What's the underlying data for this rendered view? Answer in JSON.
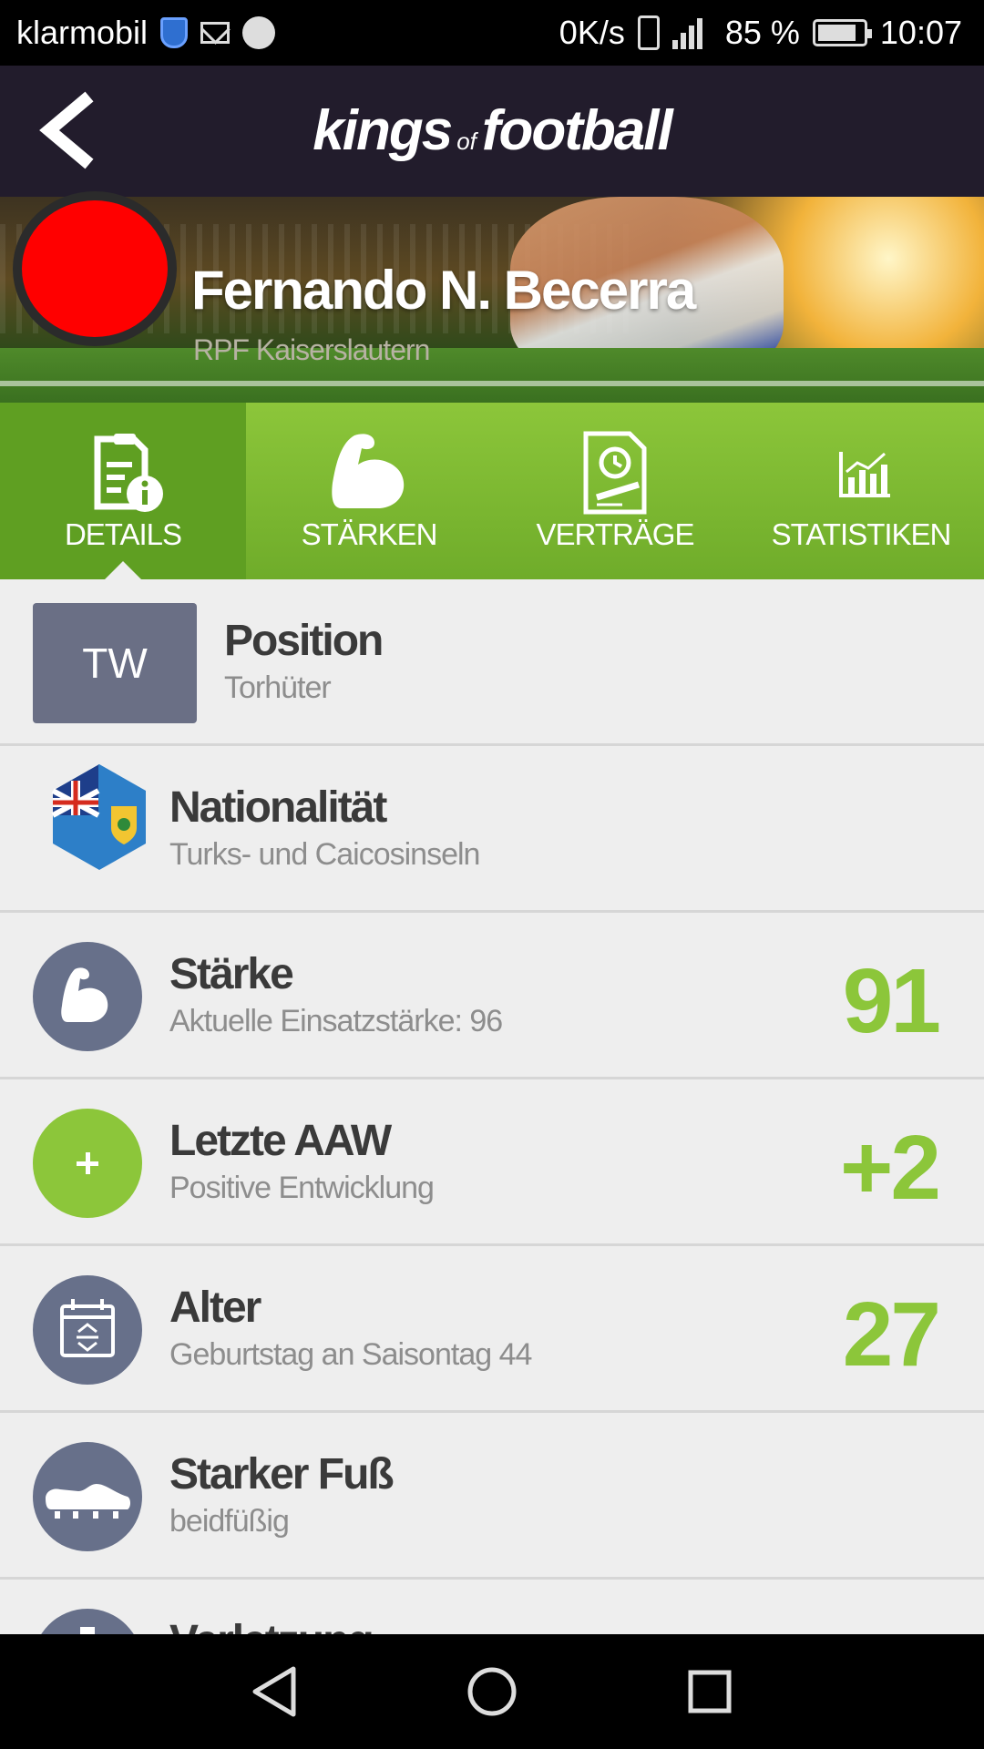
{
  "status_bar": {
    "carrier": "klarmobil",
    "speed": "0K/s",
    "battery": "85 %",
    "battery_level": 0.85,
    "time": "10:07",
    "icons": [
      "shield-icon",
      "mail-icon",
      "vodafone-icon",
      "vibrate-icon",
      "signal-icon",
      "battery-icon"
    ]
  },
  "header": {
    "logo_main1": "kings",
    "logo_of": "of",
    "logo_main2": "football"
  },
  "player": {
    "name": "Fernando N. Becerra",
    "club": "RPF Kaiserslautern",
    "avatar_color": "#ff0000"
  },
  "tabs": [
    {
      "label": "DETAILS",
      "icon": "document-info-icon",
      "active": true
    },
    {
      "label": "STÄRKEN",
      "icon": "muscle-icon",
      "active": false
    },
    {
      "label": "VERTRÄGE",
      "icon": "contract-icon",
      "active": false
    },
    {
      "label": "STATISTIKEN",
      "icon": "chart-icon",
      "active": false
    }
  ],
  "details": [
    {
      "title": "Position",
      "subtitle": "Torhüter",
      "badge": "TW"
    },
    {
      "title": "Nationalität",
      "subtitle": "Turks- und Caicosinseln",
      "icon": "flag-icon"
    },
    {
      "title": "Stärke",
      "subtitle": "Aktuelle Einsatzstärke: 96",
      "value": "91",
      "icon": "muscle-icon"
    },
    {
      "title": "Letzte AAW",
      "subtitle": "Positive Entwicklung",
      "value": "+2",
      "icon": "plus-icon"
    },
    {
      "title": "Alter",
      "subtitle": "Geburtstag an Saisontag 44",
      "value": "27",
      "icon": "calendar-icon"
    },
    {
      "title": "Starker Fuß",
      "subtitle": "beidfüßig",
      "icon": "boot-icon"
    },
    {
      "title": "Verletzung",
      "icon": "injury-icon"
    }
  ],
  "colors": {
    "accent_green": "#8cc63a",
    "header_bg": "#221c2c",
    "icon_circle": "#67708a"
  },
  "nav": [
    "back-nav-icon",
    "home-nav-icon",
    "recents-nav-icon"
  ]
}
